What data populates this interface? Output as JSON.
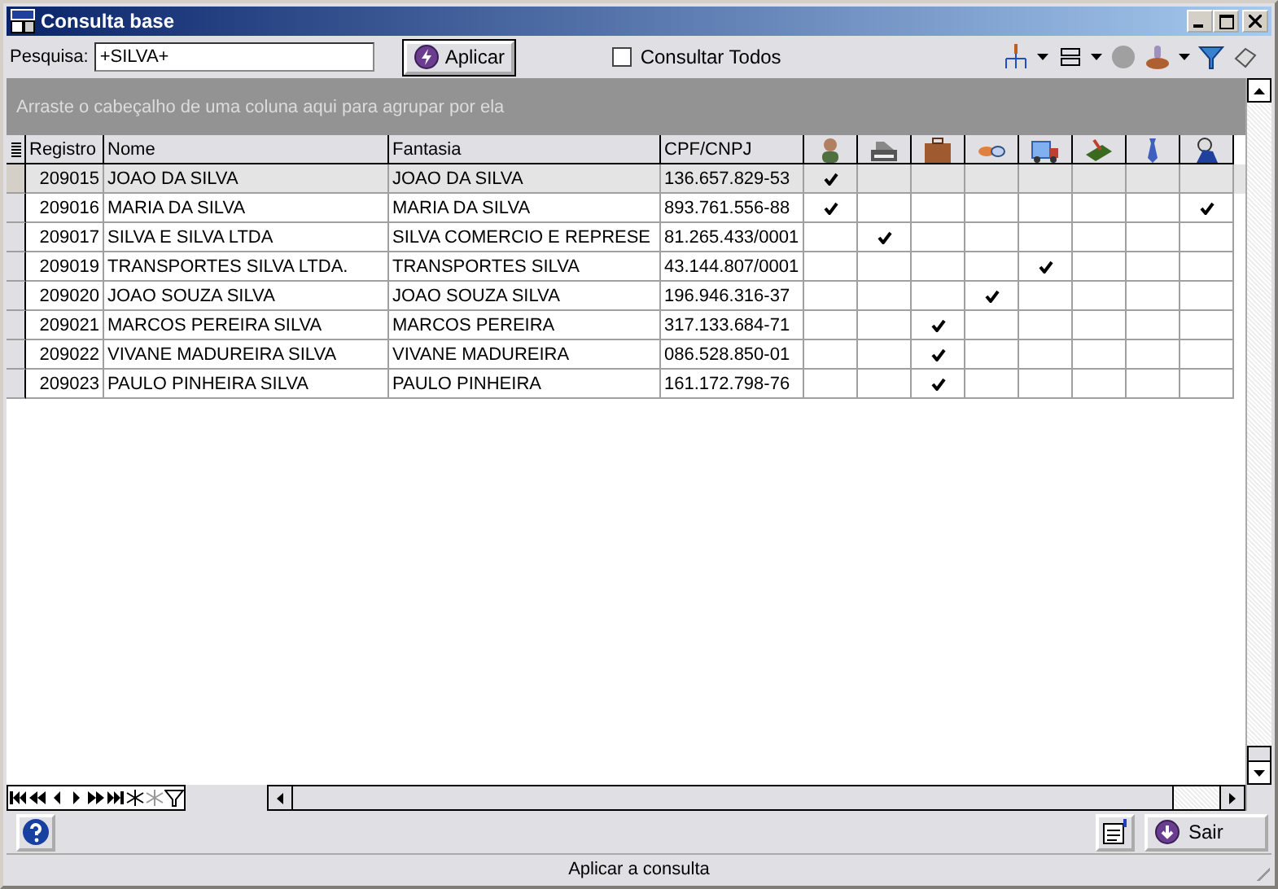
{
  "window": {
    "title": "Consulta base"
  },
  "search": {
    "label": "Pesquisa:",
    "value": "+SILVA+"
  },
  "apply_button": "Aplicar",
  "consult_all": {
    "label": "Consultar Todos",
    "checked": false
  },
  "group_panel": "Arraste o cabeçalho de uma coluna aqui para agrupar por ela",
  "table": {
    "columns": [
      "Registro",
      "Nome",
      "Fantasia",
      "CPF/CNPJ"
    ],
    "rows": [
      {
        "registro": "209015",
        "nome": "JOAO DA SILVA",
        "fantasia": "JOAO DA SILVA",
        "cpf": "136.657.829-53",
        "selected": true,
        "flags": [
          true,
          false,
          false,
          false,
          false,
          false,
          false,
          false
        ]
      },
      {
        "registro": "209016",
        "nome": "MARIA DA SILVA",
        "fantasia": "MARIA DA SILVA",
        "cpf": "893.761.556-88",
        "selected": false,
        "flags": [
          true,
          false,
          false,
          false,
          false,
          false,
          false,
          true
        ]
      },
      {
        "registro": "209017",
        "nome": "SILVA E SILVA LTDA",
        "fantasia": "SILVA COMERCIO E REPRESE",
        "cpf": "81.265.433/0001",
        "selected": false,
        "flags": [
          false,
          true,
          false,
          false,
          false,
          false,
          false,
          false
        ]
      },
      {
        "registro": "209019",
        "nome": "TRANSPORTES SILVA LTDA.",
        "fantasia": "TRANSPORTES SILVA",
        "cpf": "43.144.807/0001",
        "selected": false,
        "flags": [
          false,
          false,
          false,
          false,
          true,
          false,
          false,
          false
        ]
      },
      {
        "registro": "209020",
        "nome": "JOAO SOUZA SILVA",
        "fantasia": "JOAO SOUZA SILVA",
        "cpf": "196.946.316-37",
        "selected": false,
        "flags": [
          false,
          false,
          false,
          true,
          false,
          false,
          false,
          false
        ]
      },
      {
        "registro": "209021",
        "nome": "MARCOS PEREIRA SILVA",
        "fantasia": "MARCOS PEREIRA",
        "cpf": "317.133.684-71",
        "selected": false,
        "flags": [
          false,
          false,
          true,
          false,
          false,
          false,
          false,
          false
        ]
      },
      {
        "registro": "209022",
        "nome": "VIVANE MADUREIRA SILVA",
        "fantasia": "VIVANE MADUREIRA",
        "cpf": "086.528.850-01",
        "selected": false,
        "flags": [
          false,
          false,
          true,
          false,
          false,
          false,
          false,
          false
        ]
      },
      {
        "registro": "209023",
        "nome": "PAULO PINHEIRA SILVA",
        "fantasia": "PAULO PINHEIRA",
        "cpf": "161.172.798-76",
        "selected": false,
        "flags": [
          false,
          false,
          true,
          false,
          false,
          false,
          false,
          false
        ]
      }
    ]
  },
  "exit_button": "Sair",
  "status_bar": "Aplicar a consulta"
}
